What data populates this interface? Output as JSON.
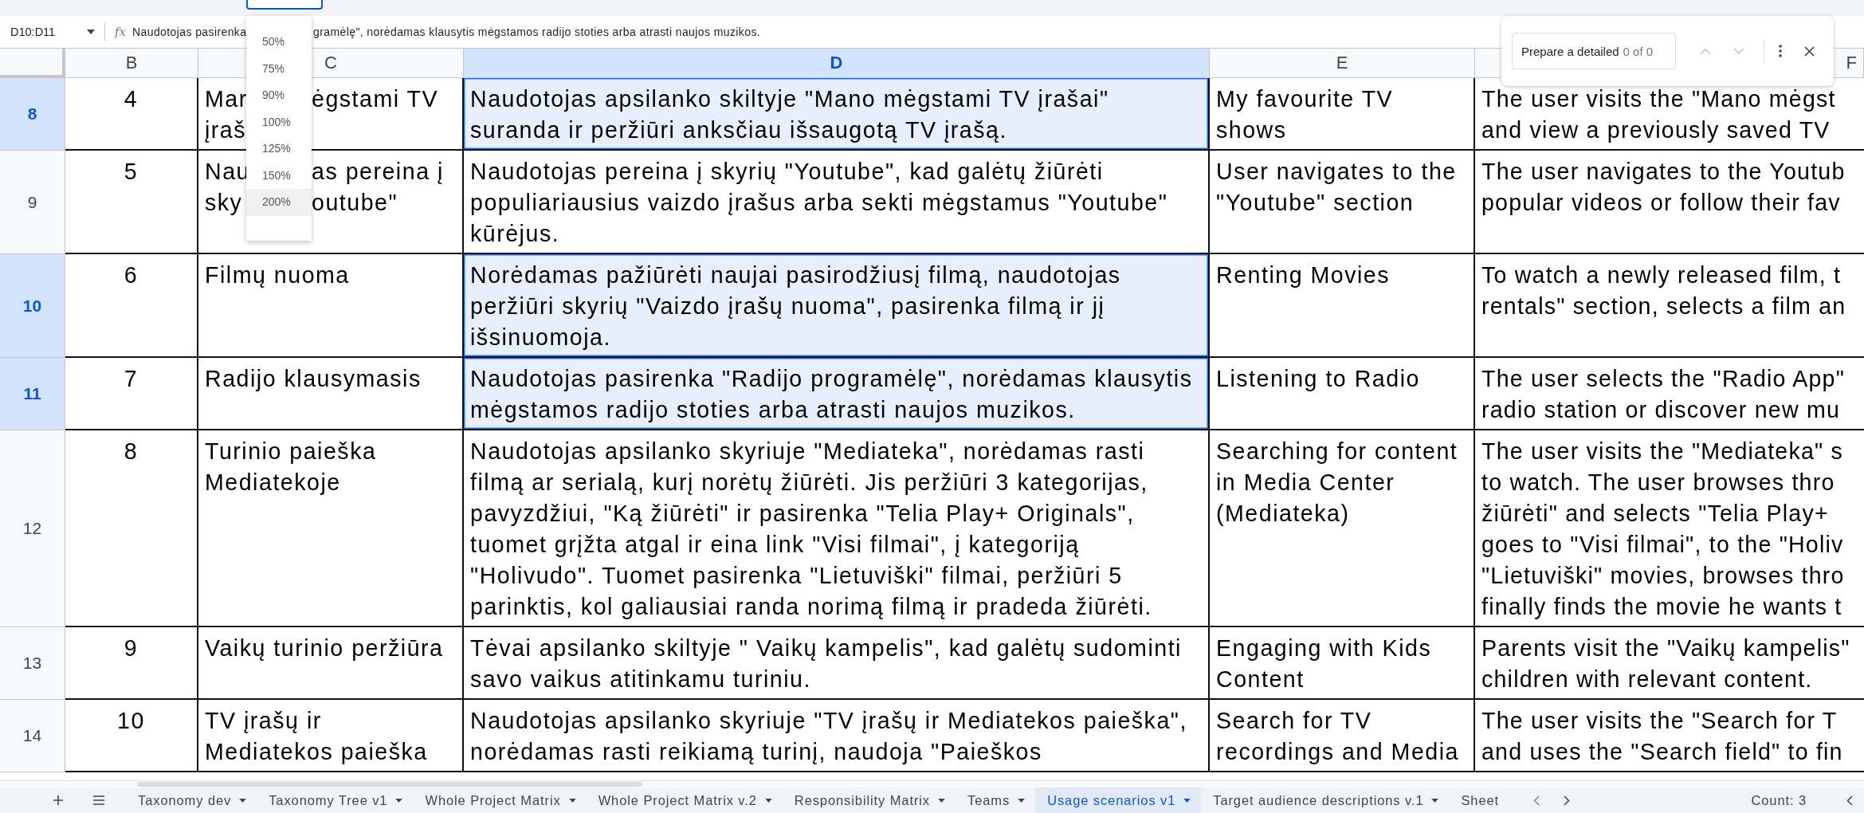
{
  "formula_bar": {
    "cell_reference": "D10:D11",
    "function_label": "fx",
    "formula_parts": [
      "Naudotojas pasirenka",
      "gramėlę\", norėdamas klausytis mėgstamos radijo stoties arba atrasti naujos muzikos."
    ]
  },
  "zoom_menu": {
    "items": [
      {
        "label": "50%",
        "selected": false
      },
      {
        "label": "75%",
        "selected": false
      },
      {
        "label": "90%",
        "selected": false
      },
      {
        "label": "100%",
        "selected": false
      },
      {
        "label": "125%",
        "selected": false
      },
      {
        "label": "150%",
        "selected": false
      },
      {
        "label": "200%",
        "selected": true
      }
    ]
  },
  "find_bar": {
    "query": "Prepare a detailed",
    "count": "0 of 0"
  },
  "columns": [
    {
      "label": "B",
      "selected": false
    },
    {
      "label": "C",
      "selected": false
    },
    {
      "label": "D",
      "selected": true
    },
    {
      "label": "E",
      "selected": false
    },
    {
      "label": "F",
      "selected": false
    }
  ],
  "rows": [
    {
      "number": "8",
      "selected": true,
      "b": "4",
      "c": [
        [
          "Mar",
          "ėgstami TV"
        ],
        [
          "įraš"
        ]
      ],
      "d": "Naudotojas apsilanko skiltyje \"Mano mėgstami TV įrašai\" suranda ir peržiūri anksčiau išsaugotą TV įrašą.",
      "e": "My favourite TV shows",
      "f": [
        "The user visits the \"Mano mėgst",
        "and view a previously saved TV"
      ]
    },
    {
      "number": "9",
      "selected": false,
      "b": "5",
      "c": [
        [
          "Nau",
          "as pereina į"
        ],
        [
          "sky",
          "outube\""
        ]
      ],
      "d": "Naudotojas pereina į skyrių \"Youtube\", kad galėtų žiūrėti populiariausius vaizdo įrašus arba sekti mėgstamus \"Youtube\" kūrėjus.",
      "e": "User navigates to the \"Youtube\" section",
      "f": [
        "The user navigates to the Youtub",
        "popular videos or follow their fav"
      ]
    },
    {
      "number": "10",
      "selected": true,
      "b": "6",
      "c": [
        [
          "Filmų nuoma"
        ]
      ],
      "d": "Norėdamas pažiūrėti naujai pasirodžiusį filmą, naudotojas peržiūri skyrių \"Vaizdo įrašų nuoma\", pasirenka filmą ir jį išsinuomoja.",
      "e": "Renting Movies",
      "f": [
        "To watch a newly released film, t",
        "rentals\" section, selects a film an"
      ]
    },
    {
      "number": "11",
      "selected": true,
      "b": "7",
      "c": [
        [
          "Radijo klausymasis"
        ]
      ],
      "d": "Naudotojas pasirenka \"Radijo programėlę\", norėdamas klausytis mėgstamos radijo stoties arba atrasti naujos muzikos.",
      "e": "Listening to Radio",
      "f": [
        "The user selects the \"Radio App\"",
        "radio station or discover new mu"
      ]
    },
    {
      "number": "12",
      "selected": false,
      "b": "8",
      "c": [
        [
          "Turinio paieška"
        ],
        [
          "Mediatekoje"
        ]
      ],
      "d": "Naudotojas apsilanko skyriuje \"Mediateka\", norėdamas rasti filmą ar serialą, kurį norėtų žiūrėti. Jis peržiūri 3 kategorijas, pavyzdžiui, \"Ką žiūrėti\" ir pasirenka \"Telia Play+ Originals\", tuomet grįžta atgal ir eina link \"Visi filmai\", į kategoriją \"Holivudo\". Tuomet pasirenka \"Lietuviški\" filmai, peržiūri 5 parinktis, kol galiausiai randa norimą filmą ir pradeda žiūrėti.",
      "e": "Searching for content in Media Center (Mediateka)",
      "f": [
        "The user visits the \"Mediateka\" s",
        "to watch. The user browses thro",
        "žiūrėti\" and selects \"Telia Play+",
        "goes to \"Visi filmai\", to the \"Holiv",
        "\"Lietuviški\" movies, browses thro",
        "finally finds the movie he wants t"
      ]
    },
    {
      "number": "13",
      "selected": false,
      "b": "9",
      "c": [
        [
          "Vaikų turinio peržiūra"
        ]
      ],
      "d": "Tėvai apsilanko skiltyje \" Vaikų kampelis\", kad galėtų sudominti savo vaikus atitinkamu turiniu.",
      "e": "Engaging with Kids Content",
      "f": [
        "Parents visit the \"Vaikų kampelis\"",
        "children with relevant content."
      ]
    },
    {
      "number": "14",
      "selected": false,
      "b": "10",
      "c": [
        [
          "TV įrašų ir"
        ],
        [
          "Mediatekos paieška"
        ]
      ],
      "d": "Naudotojas apsilanko skyriuje \"TV įrašų ir Mediatekos paieška\", norėdamas rasti reikiamą turinį, naudoja \"Paieškos",
      "e": "Search for TV recordings and Media",
      "f": [
        "The user visits the \"Search for T",
        "and uses the \"Search field\" to fin"
      ]
    }
  ],
  "sheet_tabs": [
    {
      "label": "Taxonomy dev",
      "selected": false
    },
    {
      "label": "Taxonomy Tree v1",
      "selected": false
    },
    {
      "label": "Whole Project Matrix",
      "selected": false
    },
    {
      "label": "Whole Project Matrix v.2",
      "selected": false
    },
    {
      "label": "Responsibility Matrix",
      "selected": false
    },
    {
      "label": "Teams",
      "selected": false
    },
    {
      "label": "Usage scenarios v1",
      "selected": true
    },
    {
      "label": "Target audience descriptions v.1",
      "selected": false
    },
    {
      "label": "Sheet",
      "selected": false
    }
  ],
  "status": {
    "count": "Count: 3"
  }
}
